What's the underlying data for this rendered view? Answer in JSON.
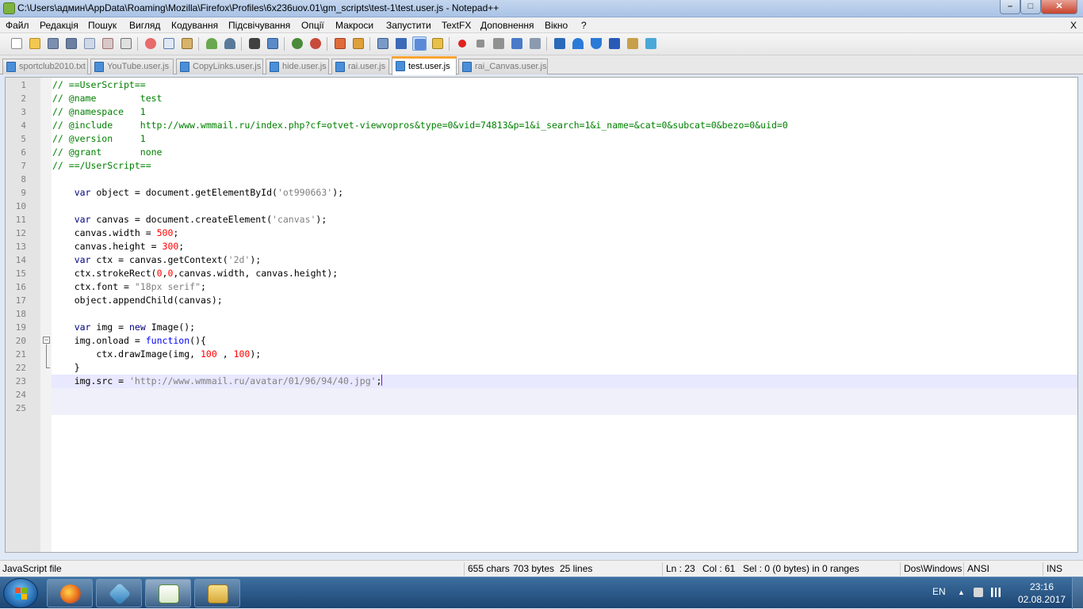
{
  "window": {
    "title": "C:\\Users\\админ\\AppData\\Roaming\\Mozilla\\Firefox\\Profiles\\6x236uov.01\\gm_scripts\\test-1\\test.user.js - Notepad++",
    "min_glyph": "–",
    "max_glyph": "□",
    "close_glyph": "✕"
  },
  "menu": {
    "items": [
      "Файл",
      "Редакція",
      "Пошук",
      "Вигляд",
      "Кодування",
      "Підсвічування",
      "Опції",
      "Макроси",
      "Запустити",
      "TextFX",
      "Доповнення",
      "Вікно",
      "?"
    ],
    "close_label": "X"
  },
  "tabs": [
    {
      "label": "sportclub2010.txt",
      "active": false
    },
    {
      "label": "YouTube.user.js",
      "active": false
    },
    {
      "label": "CopyLinks.user.js",
      "active": false
    },
    {
      "label": "hide.user.js",
      "active": false
    },
    {
      "label": "rai.user.js",
      "active": false
    },
    {
      "label": "test.user.js",
      "active": true
    },
    {
      "label": "rai_Canvas.user.js",
      "active": false
    }
  ],
  "editor": {
    "current_line": 23,
    "lines": [
      {
        "n": "1",
        "code": "// ==UserScript=="
      },
      {
        "n": "2",
        "code": "// @name        test"
      },
      {
        "n": "3",
        "code": "// @namespace   1"
      },
      {
        "n": "4",
        "code": "// @include     http://www.wmmail.ru/index.php?cf=otvet-viewvopros&type=0&vid=74813&p=1&i_search=1&i_name=&cat=0&subcat=0&bezo=0&uid=0"
      },
      {
        "n": "5",
        "code": "// @version     1"
      },
      {
        "n": "6",
        "code": "// @grant       none"
      },
      {
        "n": "7",
        "code": "// ==/UserScript=="
      },
      {
        "n": "8",
        "code": ""
      },
      {
        "n": "9",
        "code": "    var object = document.getElementById('ot990663');"
      },
      {
        "n": "10",
        "code": ""
      },
      {
        "n": "11",
        "code": "    var canvas = document.createElement('canvas');"
      },
      {
        "n": "12",
        "code": "    canvas.width = 500;"
      },
      {
        "n": "13",
        "code": "    canvas.height = 300;"
      },
      {
        "n": "14",
        "code": "    var ctx = canvas.getContext('2d');"
      },
      {
        "n": "15",
        "code": "    ctx.strokeRect(0,0,canvas.width, canvas.height);"
      },
      {
        "n": "16",
        "code": "    ctx.font = \"18px serif\";"
      },
      {
        "n": "17",
        "code": "    object.appendChild(canvas);"
      },
      {
        "n": "18",
        "code": ""
      },
      {
        "n": "19",
        "code": "    var img = new Image();"
      },
      {
        "n": "20",
        "code": "    img.onload = function(){"
      },
      {
        "n": "21",
        "code": "        ctx.drawImage(img, 100 , 100);"
      },
      {
        "n": "22",
        "code": "    }"
      },
      {
        "n": "23",
        "code": "    img.src = 'http://www.wmmail.ru/avatar/01/96/94/40.jpg';"
      },
      {
        "n": "24",
        "code": ""
      },
      {
        "n": "25",
        "code": ""
      }
    ]
  },
  "status": {
    "file_type": "JavaScript file",
    "chars": "655 chars",
    "bytes": "703 bytes",
    "lines": "25 lines",
    "ln": "Ln : 23",
    "col": "Col : 61",
    "sel": "Sel : 0 (0 bytes) in 0 ranges",
    "eol": "Dos\\Windows",
    "encoding": "ANSI",
    "mode": "INS"
  },
  "taskbar": {
    "apps": [
      "firefox",
      "virtualbox",
      "notepad-plus-plus",
      "file-explorer"
    ],
    "lang": "EN",
    "time": "23:16",
    "date": "02.08.2017"
  },
  "colors": {
    "comment": "#008000",
    "keyword": "#000080",
    "number": "#ff0000",
    "string": "#808080",
    "current_line_bg": "#e8e8ff",
    "active_tab_accent": "#f8a431"
  }
}
